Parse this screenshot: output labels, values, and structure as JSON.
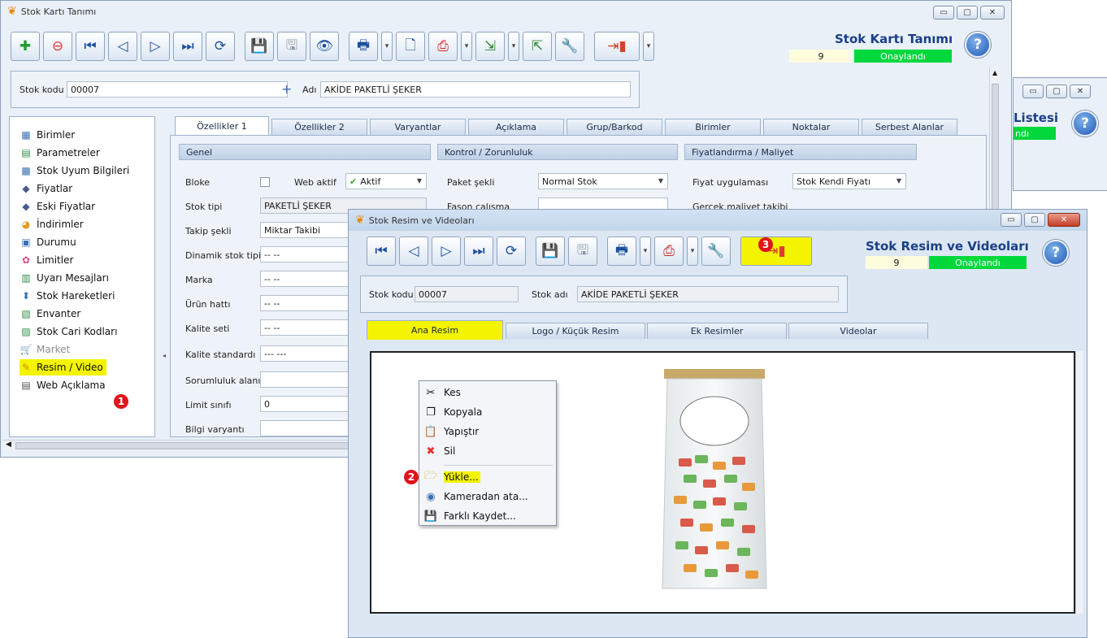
{
  "main_window": {
    "title": "Stok Kartı Tanımı",
    "header_title": "Stok Kartı Tanımı",
    "status_number": "9",
    "status_label": "Onaylandı",
    "help_label": "?",
    "stock_code_label": "Stok kodu",
    "stock_code_value": "00007",
    "name_label": "Adı",
    "name_value": "AKİDE PAKETLİ ŞEKER",
    "tabs": [
      "Özellikler 1",
      "Özellikler 2",
      "Varyantlar",
      "Açıklama",
      "Grup/Barkod",
      "Birimler",
      "Noktalar",
      "Serbest Alanlar"
    ],
    "sidebar": [
      {
        "label": "Birimler",
        "icon": "units-icon"
      },
      {
        "label": "Parametreler",
        "icon": "parameters-icon"
      },
      {
        "label": "Stok Uyum Bilgileri",
        "icon": "compat-icon"
      },
      {
        "label": "Fiyatlar",
        "icon": "price-icon"
      },
      {
        "label": "Eski Fiyatlar",
        "icon": "old-price-icon"
      },
      {
        "label": "İndirimler",
        "icon": "discount-icon"
      },
      {
        "label": "Durumu",
        "icon": "status-icon"
      },
      {
        "label": "Limitler",
        "icon": "limits-icon"
      },
      {
        "label": "Uyarı Mesajları",
        "icon": "warning-icon"
      },
      {
        "label": "Stok Hareketleri",
        "icon": "movements-icon"
      },
      {
        "label": "Envanter",
        "icon": "inventory-icon"
      },
      {
        "label": "Stok Cari Kodları",
        "icon": "account-codes-icon"
      },
      {
        "label": "Market",
        "icon": "market-icon"
      },
      {
        "label": "Resim / Video",
        "icon": "image-video-icon"
      },
      {
        "label": "Web Açıklama",
        "icon": "web-description-icon"
      }
    ],
    "groups": {
      "genel": "Genel",
      "kontrol": "Kontrol / Zorunluluk",
      "fiyat": "Fiyatlandırma / Maliyet"
    },
    "genel_fields": [
      {
        "label": "Bloke",
        "value": ""
      },
      {
        "label": "Stok tipi",
        "value": "PAKETLİ ŞEKER"
      },
      {
        "label": "Takip şekli",
        "value": "Miktar Takibi"
      },
      {
        "label": "Dinamik stok tipi",
        "value": "-- --"
      },
      {
        "label": "Marka",
        "value": "-- --"
      },
      {
        "label": "Ürün hattı",
        "value": "-- --"
      },
      {
        "label": "Kalite seti",
        "value": "-- --"
      },
      {
        "label": "Kalite standardı",
        "value": "--- ---"
      },
      {
        "label": "Sorumluluk alanı",
        "value": ""
      },
      {
        "label": "Limit sınıfı",
        "value": "0"
      },
      {
        "label": "Bilgi varyantı",
        "value": ""
      }
    ],
    "web_aktif_label": "Web aktif",
    "web_aktif_value": "Aktif",
    "paket_sekli_label": "Paket şekli",
    "paket_sekli_value": "Normal Stok",
    "fason_label": "Fason çalışma",
    "fiyat_uyg_label": "Fiyat uygulaması",
    "fiyat_uyg_value": "Stok Kendi Fiyatı",
    "gercek_maliyet_label": "Gerçek maliyet takibi"
  },
  "back_window": {
    "title_fragment": "Listesi",
    "status_fragment": "ndı"
  },
  "media_window": {
    "title": "Stok Resim ve Videoları",
    "header_title": "Stok Resim ve Videoları",
    "status_number": "9",
    "status_label": "Onaylandı",
    "help_label": "?",
    "stock_code_label": "Stok kodu",
    "stock_code_value": "00007",
    "stock_name_label": "Stok adı",
    "stock_name_value": "AKİDE PAKETLİ ŞEKER",
    "tabs": [
      "Ana Resim",
      "Logo / Küçük Resim",
      "Ek Resimler",
      "Videolar"
    ]
  },
  "context_menu": [
    {
      "label": "Kes",
      "icon": "scissors-icon"
    },
    {
      "label": "Kopyala",
      "icon": "copy-icon"
    },
    {
      "label": "Yapıştır",
      "icon": "paste-icon"
    },
    {
      "label": "Sil",
      "icon": "delete-icon"
    },
    {
      "label": "Yükle...",
      "icon": "folder-open-icon"
    },
    {
      "label": "Kameradan ata...",
      "icon": "camera-icon"
    },
    {
      "label": "Farklı Kaydet...",
      "icon": "save-as-icon"
    }
  ],
  "badges": [
    "1",
    "2",
    "3"
  ],
  "colors": {
    "highlight": "#f4f400",
    "approved": "#00d83c",
    "badge": "#e0141b",
    "title_blue": "#1b3f84"
  }
}
